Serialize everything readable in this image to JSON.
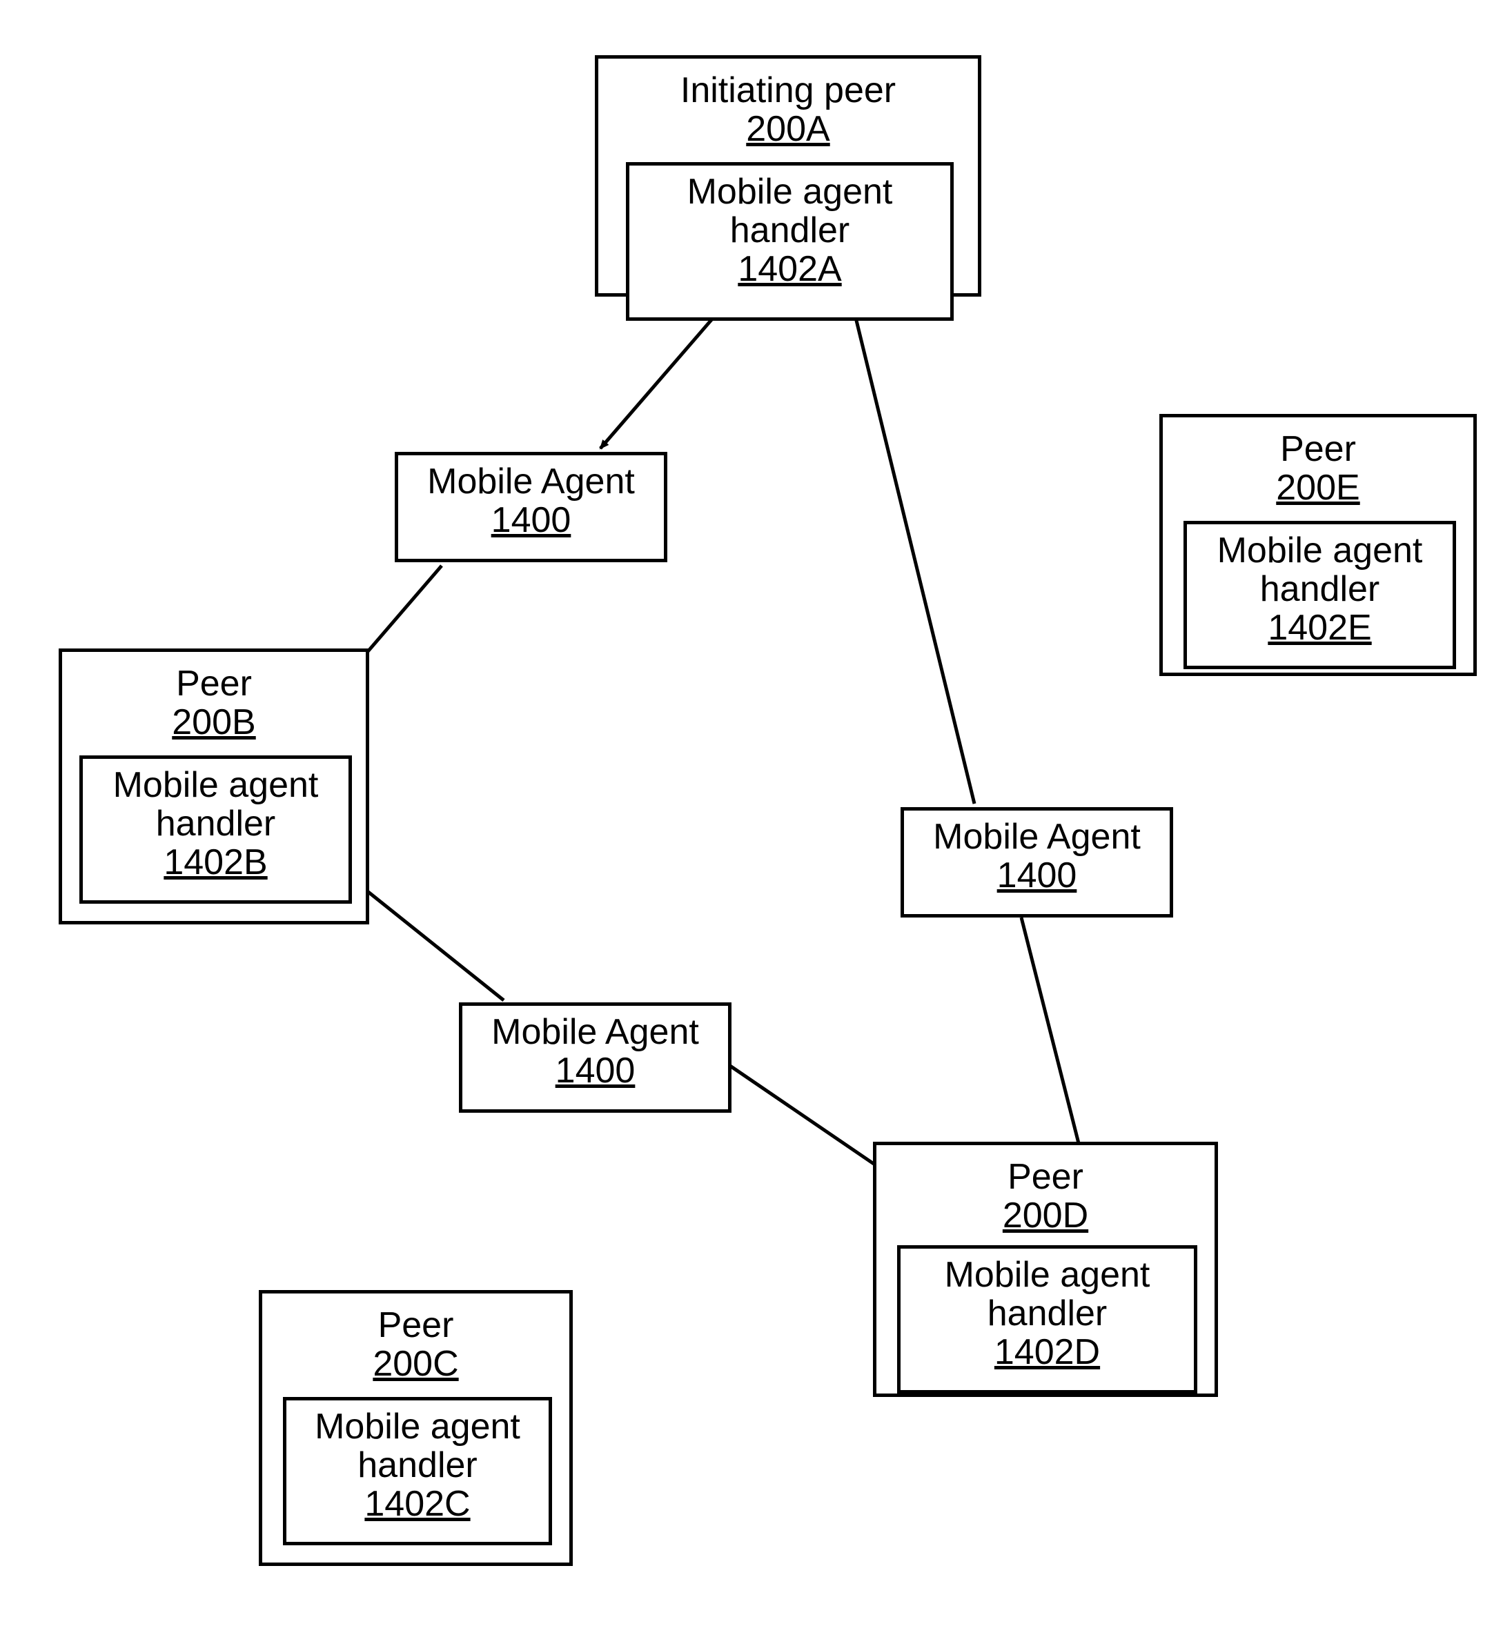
{
  "peers": {
    "A": {
      "title": "Initiating peer",
      "id": "200A",
      "handler_title": "Mobile agent handler",
      "handler_id": "1402A"
    },
    "B": {
      "title": "Peer",
      "id": "200B",
      "handler_title": "Mobile agent handler",
      "handler_id": "1402B"
    },
    "C": {
      "title": "Peer",
      "id": "200C",
      "handler_title": "Mobile agent handler",
      "handler_id": "1402C"
    },
    "D": {
      "title": "Peer",
      "id": "200D",
      "handler_title": "Mobile agent handler",
      "handler_id": "1402D"
    },
    "E": {
      "title": "Peer",
      "id": "200E",
      "handler_title": "Mobile agent handler",
      "handler_id": "1402E"
    }
  },
  "agents": {
    "ab": {
      "title": "Mobile Agent",
      "id": "1400"
    },
    "bd": {
      "title": "Mobile Agent",
      "id": "1400"
    },
    "da": {
      "title": "Mobile Agent",
      "id": "1400"
    }
  }
}
